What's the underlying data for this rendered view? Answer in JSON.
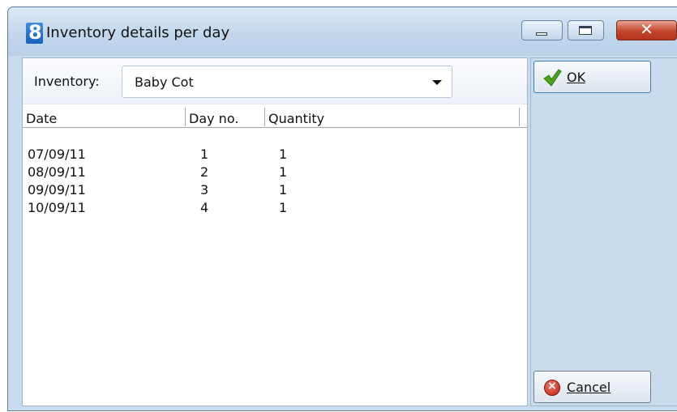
{
  "window": {
    "title": "Inventory details per day",
    "app_icon_glyph": "8",
    "controls": {
      "minimize": "minimize-icon",
      "maximize": "maximize-icon",
      "close_glyph": "✕"
    }
  },
  "inventory": {
    "label": "Inventory:",
    "selected": "Baby Cot"
  },
  "grid": {
    "columns": [
      "Date",
      "Day no.",
      "Quantity"
    ],
    "rows": [
      {
        "date": "07/09/11",
        "day_no": "1",
        "quantity": "1"
      },
      {
        "date": "08/09/11",
        "day_no": "2",
        "quantity": "1"
      },
      {
        "date": "09/09/11",
        "day_no": "3",
        "quantity": "1"
      },
      {
        "date": "10/09/11",
        "day_no": "4",
        "quantity": "1"
      }
    ]
  },
  "buttons": {
    "ok": {
      "label": "OK",
      "icon": "checkmark-icon"
    },
    "cancel": {
      "label": "Cancel",
      "icon": "cancel-icon"
    }
  },
  "colors": {
    "window_frame": "#c9dcee",
    "checkmark": "#4aa51c",
    "cancel": "#c21d10"
  }
}
